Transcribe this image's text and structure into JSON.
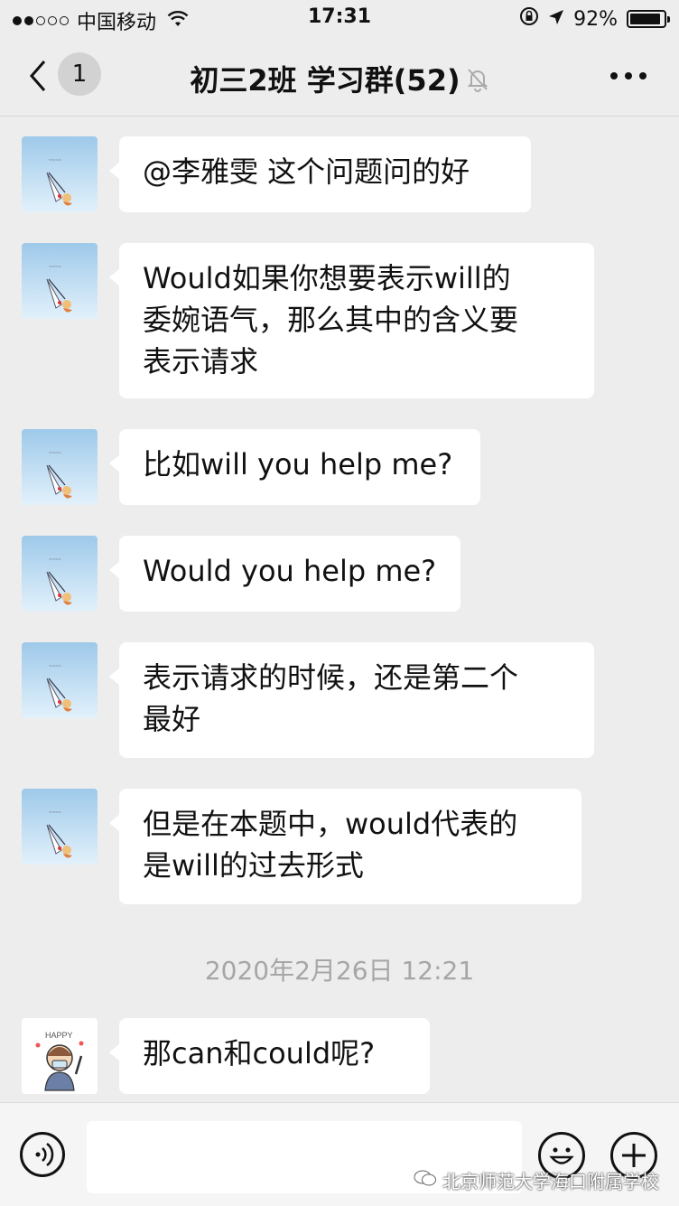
{
  "status_bar": {
    "carrier": "中国移动",
    "time": "17:31",
    "battery": "92%",
    "battery_level": 0.92
  },
  "nav": {
    "unread_count": "1",
    "title": "初三2班 学习群(52)"
  },
  "messages": [
    {
      "sender_avatar": "landscape-avatar",
      "text": "@李雅雯 这个问题问的好"
    },
    {
      "sender_avatar": "landscape-avatar",
      "text": "Would如果你想要表示will的\n委婉语气，那么其中的含义要\n表示请求"
    },
    {
      "sender_avatar": "landscape-avatar",
      "text": "比如will you help me?"
    },
    {
      "sender_avatar": "landscape-avatar",
      "text": "Would you help me?"
    },
    {
      "sender_avatar": "landscape-avatar",
      "text": "表示请求的时候，还是第二个\n最好"
    },
    {
      "sender_avatar": "landscape-avatar",
      "text": "但是在本题中，would代表的\n是will的过去形式"
    },
    {
      "sender_avatar": "cartoon-avatar",
      "text": "那can和could呢?"
    }
  ],
  "timestamp": "2020年2月26日 12:21",
  "input_bar": {
    "value": ""
  },
  "watermark": "北京师范大学海口附属学校",
  "colors": {
    "background": "#ededed",
    "bubble": "#ffffff",
    "timestamp": "#a6a6a6"
  }
}
